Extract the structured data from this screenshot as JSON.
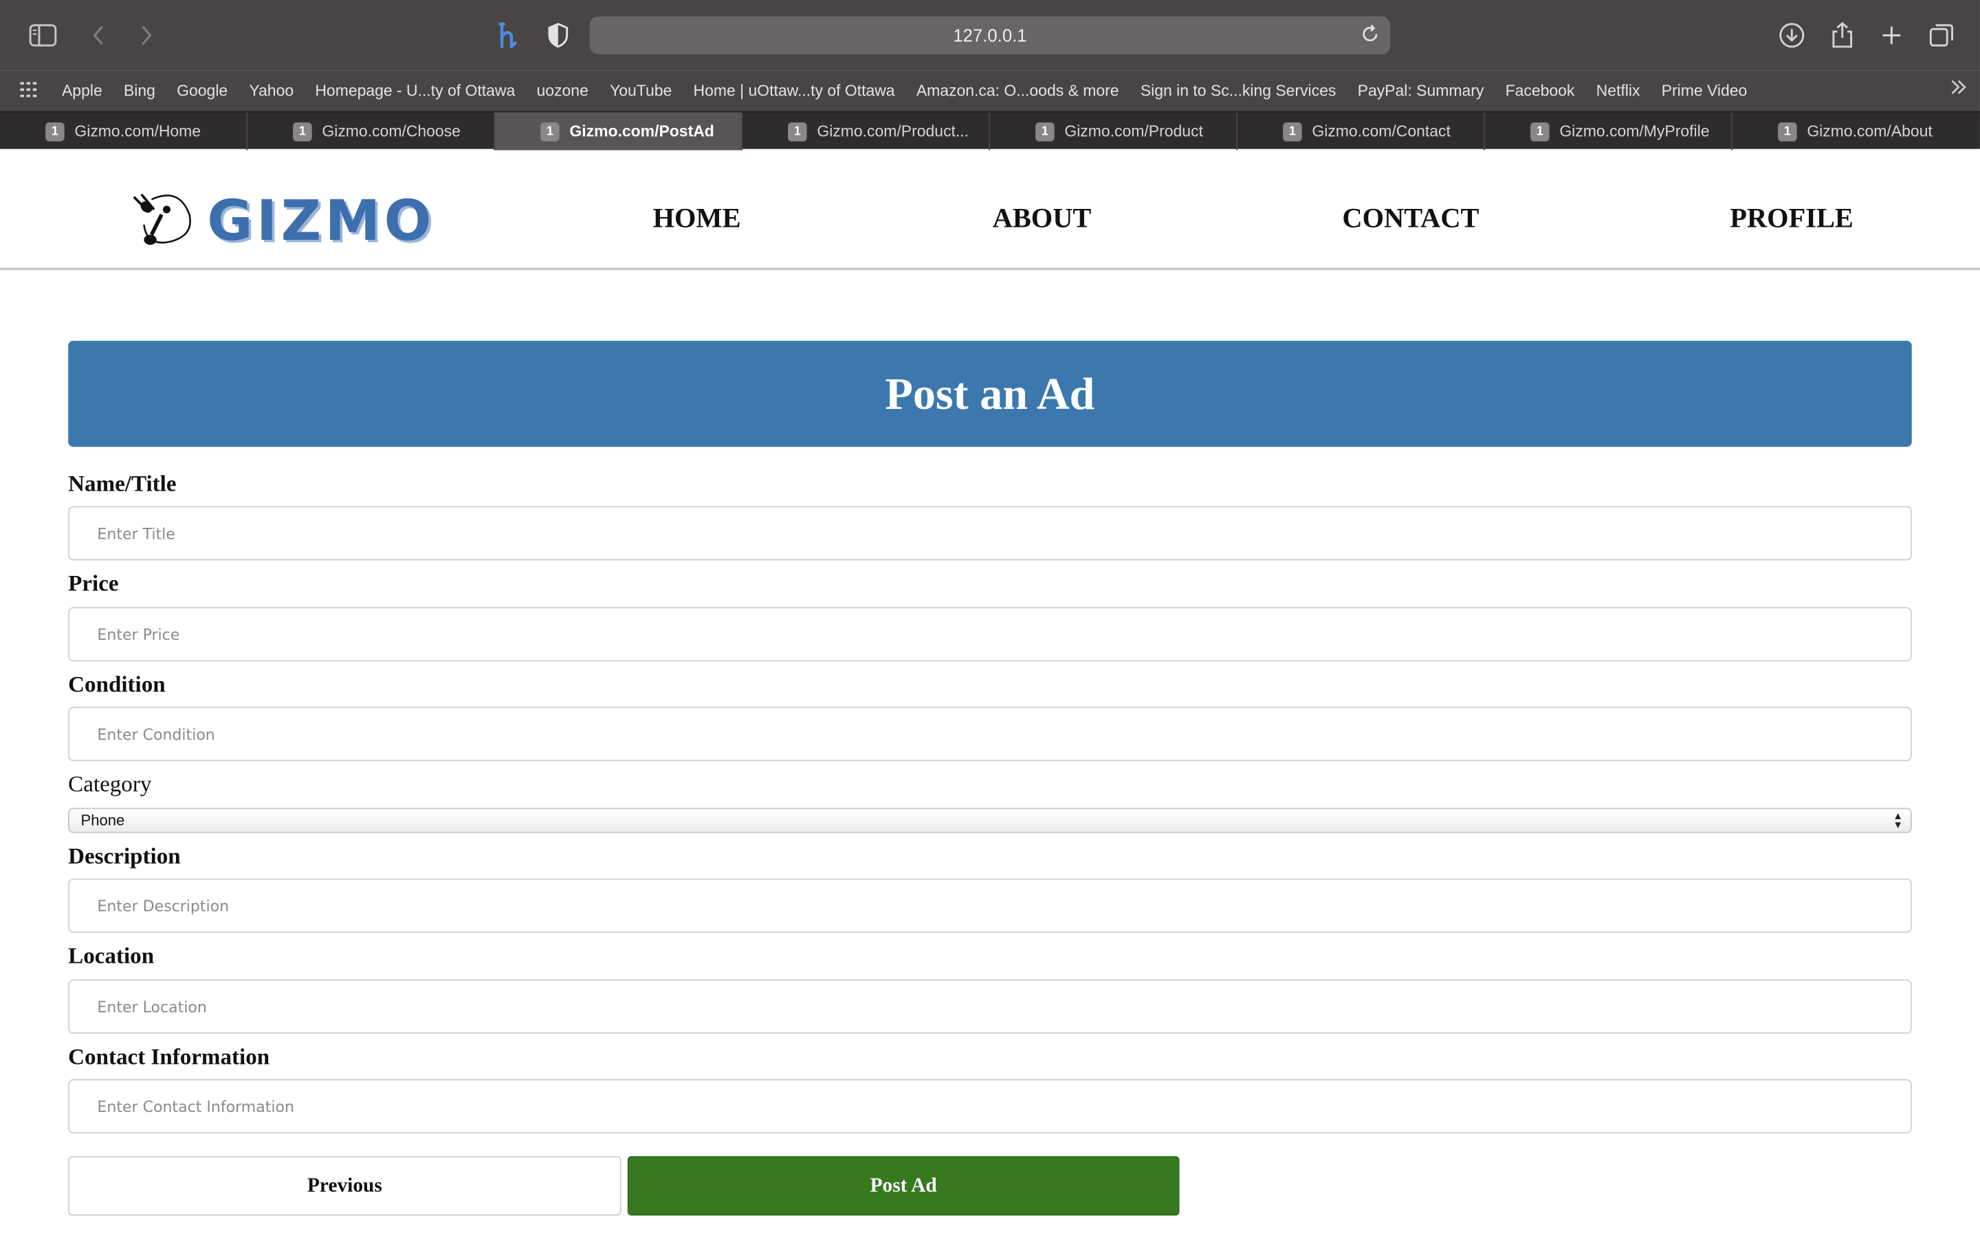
{
  "browser": {
    "address": "127.0.0.1",
    "bookmarks": [
      "Apple",
      "Bing",
      "Google",
      "Yahoo",
      "Homepage - U...ty of Ottawa",
      "uozone",
      "YouTube",
      "Home | uOttaw...ty of Ottawa",
      "Amazon.ca: O...oods & more",
      "Sign in to Sc...king Services",
      "PayPal: Summary",
      "Facebook",
      "Netflix",
      "Prime Video"
    ],
    "tabs": [
      {
        "num": "1",
        "title": "Gizmo.com/Home"
      },
      {
        "num": "1",
        "title": "Gizmo.com/Choose"
      },
      {
        "num": "1",
        "title": "Gizmo.com/PostAd"
      },
      {
        "num": "1",
        "title": "Gizmo.com/Product..."
      },
      {
        "num": "1",
        "title": "Gizmo.com/Product"
      },
      {
        "num": "1",
        "title": "Gizmo.com/Contact"
      },
      {
        "num": "1",
        "title": "Gizmo.com/MyProfile"
      },
      {
        "num": "1",
        "title": "Gizmo.com/About"
      }
    ]
  },
  "site": {
    "logo_text": "GIZMO",
    "nav": {
      "home": "HOME",
      "about": "ABOUT",
      "contact": "CONTACT",
      "profile": "PROFILE"
    }
  },
  "form": {
    "heading": "Post an Ad",
    "title_label": "Name/Title",
    "title_placeholder": "Enter Title",
    "price_label": "Price",
    "price_placeholder": "Enter Price",
    "condition_label": "Condition",
    "condition_placeholder": "Enter Condition",
    "category_label": "Category",
    "category_value": "Phone",
    "description_label": "Description",
    "description_placeholder": "Enter Description",
    "location_label": "Location",
    "location_placeholder": "Enter Location",
    "contact_label": "Contact Information",
    "contact_placeholder": "Enter Contact Information",
    "previous_label": "Previous",
    "post_label": "Post Ad"
  },
  "colors": {
    "banner": "#3c78ae",
    "post_button": "#37791f",
    "logo": "#3d6fae"
  }
}
